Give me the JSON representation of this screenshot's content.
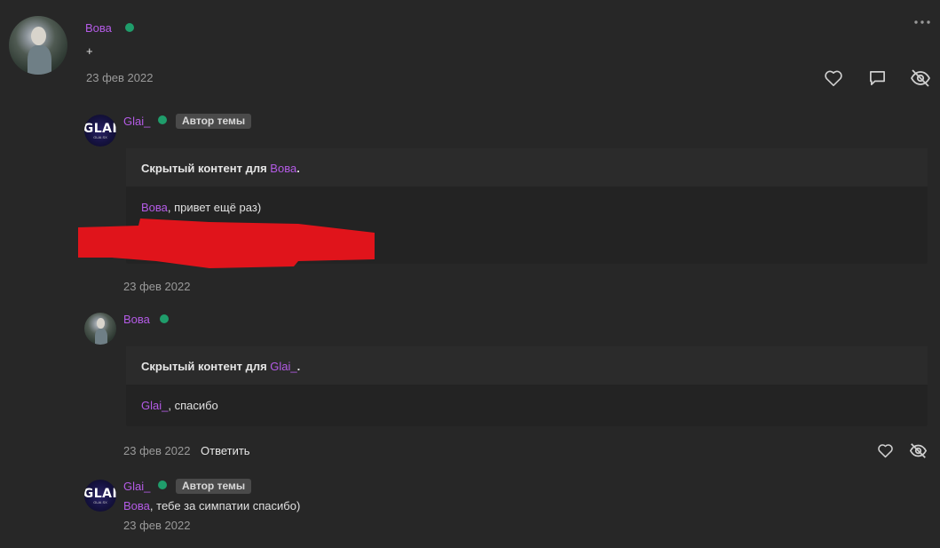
{
  "post": {
    "author": "Вова",
    "body": "+",
    "date": "23 фев 2022"
  },
  "replies": [
    {
      "author": "Glai_",
      "badge": "Автор темы",
      "hidden_label": "Скрытый контент для",
      "hidden_for": "Вова",
      "hidden_dot": ".",
      "mention": "Вова",
      "body": ", привет ещё раз)",
      "date": "23 фев 2022"
    },
    {
      "author": "Вова",
      "hidden_label": "Скрытый контент для",
      "hidden_for": "Glai_",
      "hidden_dot": ".",
      "mention": "Glai_",
      "body": ", спасибо",
      "date": "23 фев 2022",
      "reply_label": "Ответить"
    },
    {
      "author": "Glai_",
      "badge": "Автор темы",
      "mention": "Вова",
      "body": ", тебе за симпатии спасибо)",
      "date": "23 фев 2022"
    }
  ],
  "avatar_logo": {
    "text": "GLAI",
    "subtext": "GLAI.SX"
  },
  "icons": {
    "more": "more-icon",
    "like": "heart-icon",
    "comment": "comment-icon",
    "hide": "eye-slash-icon"
  },
  "colors": {
    "background": "#272727",
    "username": "#b45be6",
    "online": "#1f9d6b",
    "redaction": "#e0141b"
  }
}
